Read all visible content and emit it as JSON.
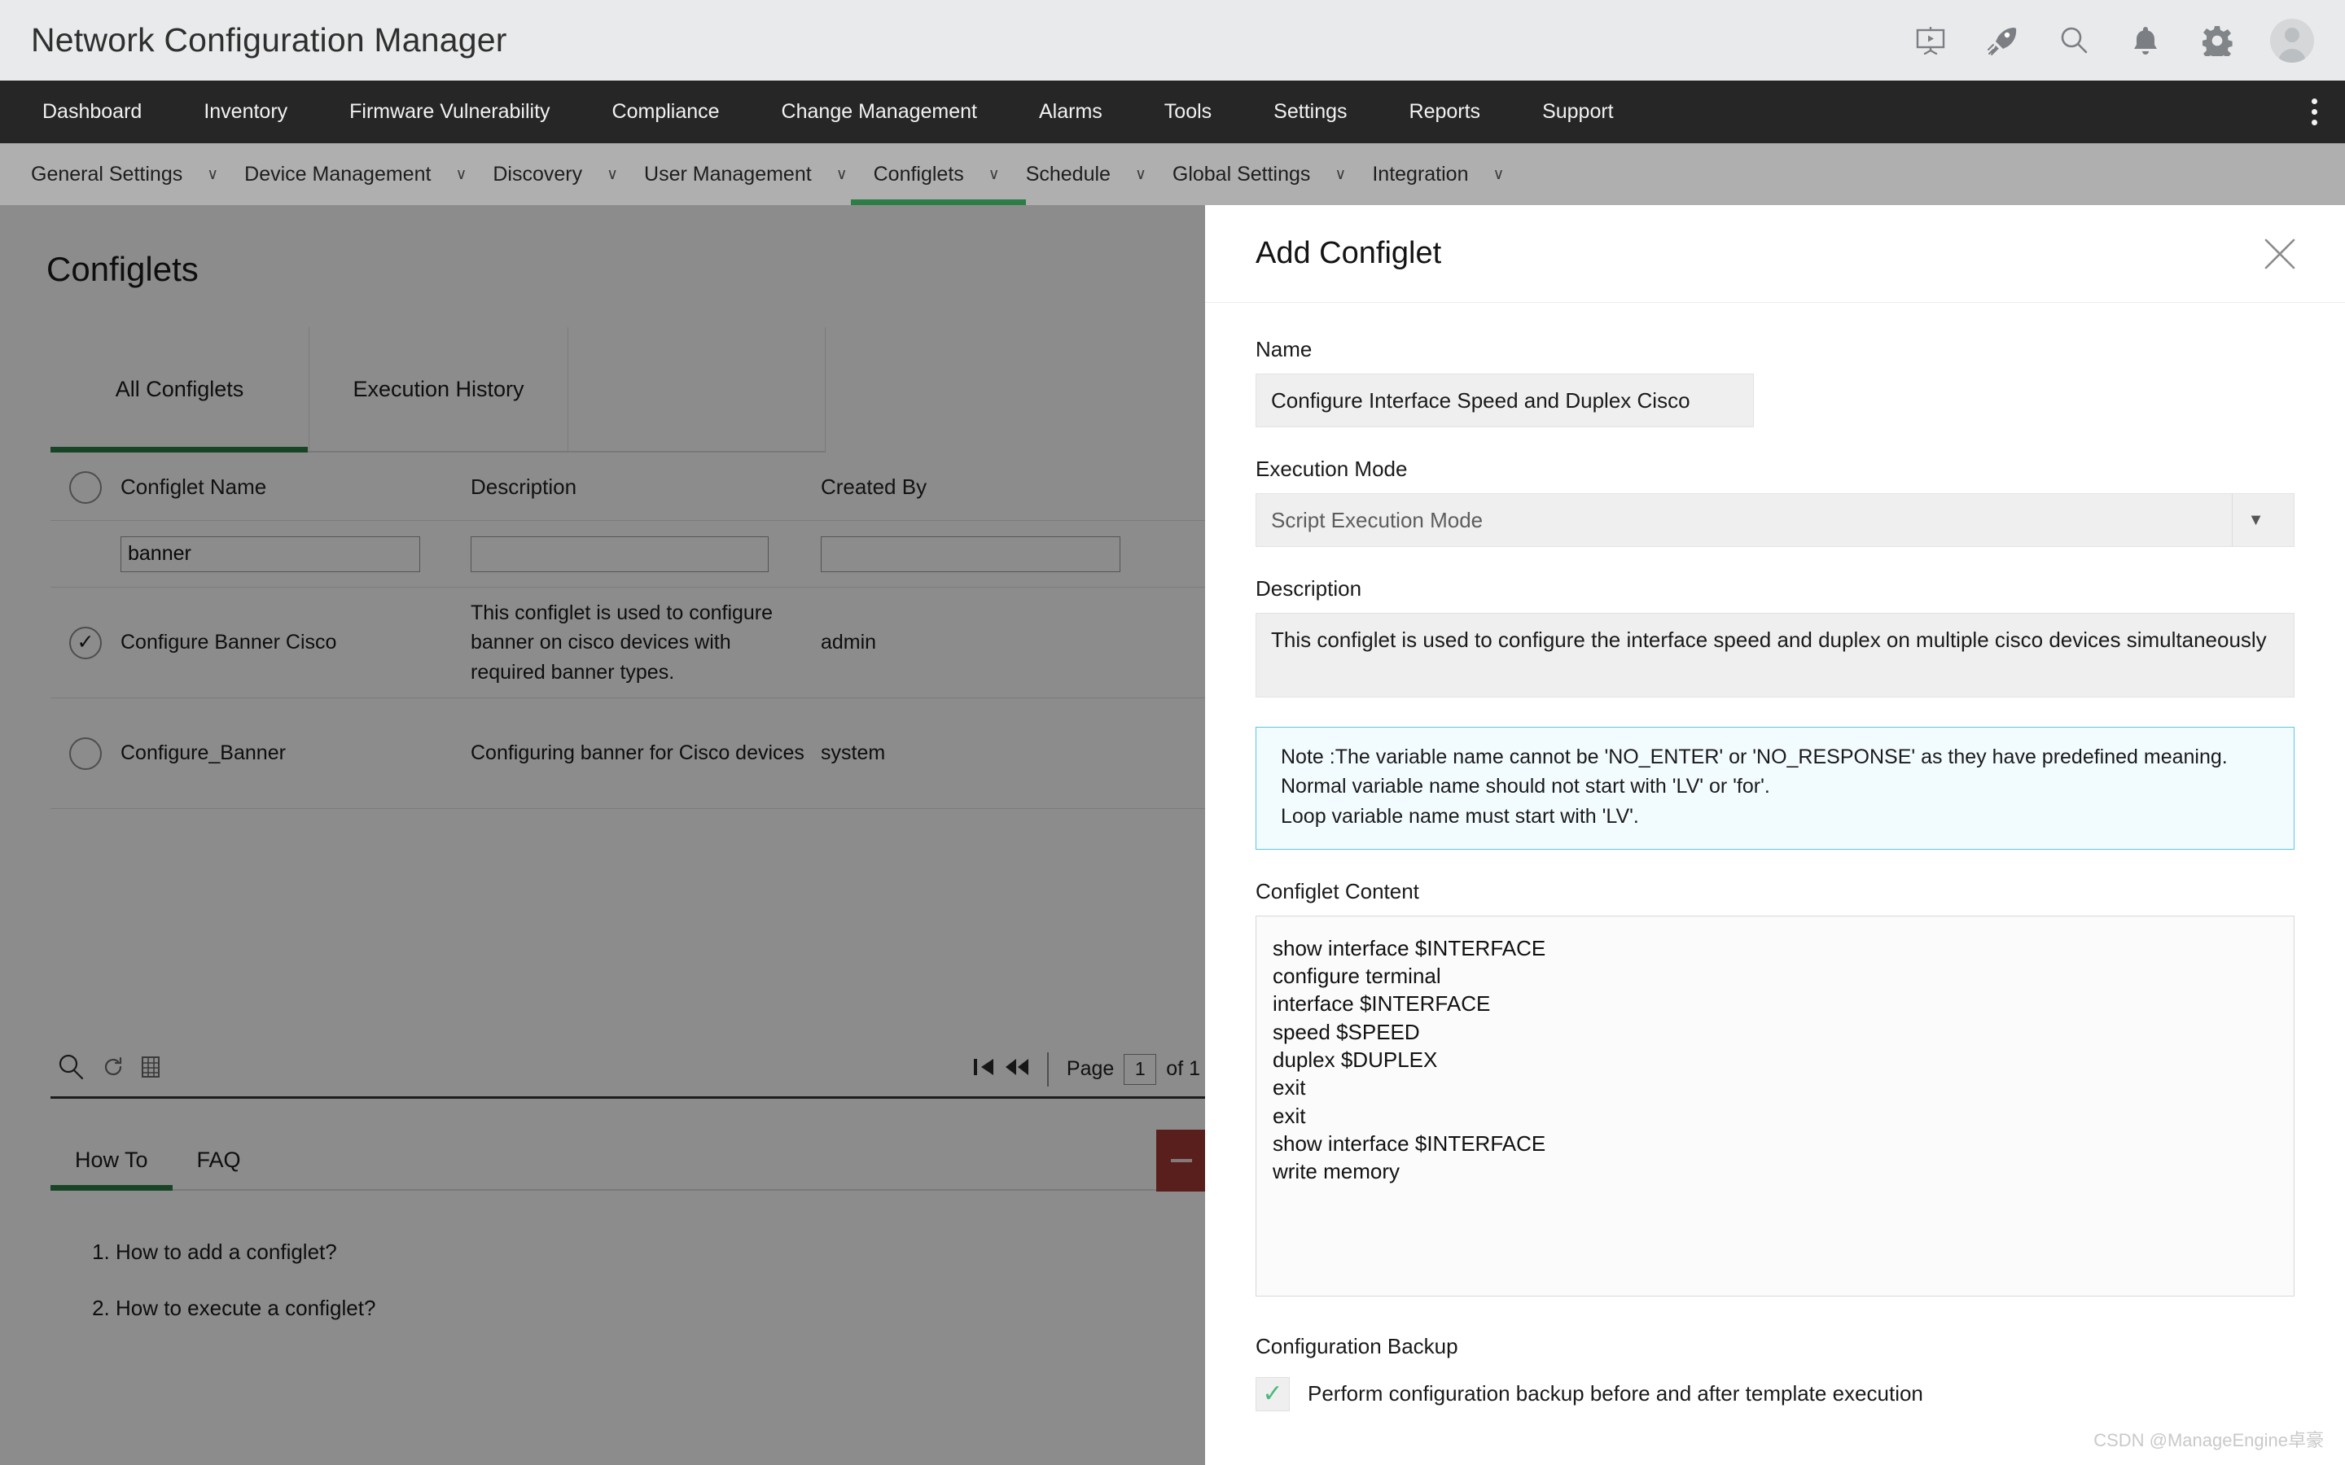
{
  "header": {
    "title": "Network Configuration Manager",
    "icons": [
      {
        "name": "presentation-demo-icon"
      },
      {
        "name": "rocket-icon"
      },
      {
        "name": "search-icon"
      },
      {
        "name": "bell-notification-icon"
      },
      {
        "name": "gear-settings-icon"
      },
      {
        "name": "user-avatar-icon"
      }
    ]
  },
  "main_nav": {
    "items": [
      {
        "label": "Dashboard"
      },
      {
        "label": "Inventory"
      },
      {
        "label": "Firmware Vulnerability"
      },
      {
        "label": "Compliance"
      },
      {
        "label": "Change Management"
      },
      {
        "label": "Alarms"
      },
      {
        "label": "Tools"
      },
      {
        "label": "Settings"
      },
      {
        "label": "Reports"
      },
      {
        "label": "Support"
      }
    ],
    "overflow_icon": "kebab-menu-icon"
  },
  "sub_nav": {
    "active": "Configlets",
    "items": [
      {
        "label": "General Settings",
        "caret": "∨"
      },
      {
        "label": "Device Management",
        "caret": "∨"
      },
      {
        "label": "Discovery",
        "caret": "∨"
      },
      {
        "label": "User Management",
        "caret": "∨"
      },
      {
        "label": "Configlets",
        "caret": "∨"
      },
      {
        "label": "Schedule",
        "caret": "∨"
      },
      {
        "label": "Global Settings",
        "caret": "∨"
      },
      {
        "label": "Integration",
        "caret": "∨"
      }
    ]
  },
  "page": {
    "title": "Configlets",
    "tabs": [
      {
        "label": "All Configlets",
        "active": true
      },
      {
        "label": "Execution History",
        "active": false
      }
    ]
  },
  "table": {
    "columns": [
      "Configlet Name",
      "Description",
      "Created By"
    ],
    "filters": {
      "configlet_name": "banner",
      "description": "",
      "created_by": ""
    },
    "rows": [
      {
        "selected": true,
        "name": "Configure Banner Cisco",
        "description": "This configlet is used to configure banner on cisco devices with required banner types.",
        "created_by": "admin"
      },
      {
        "selected": false,
        "name": "Configure_Banner",
        "description": "Configuring banner for Cisco devices",
        "created_by": "system"
      }
    ],
    "footer": {
      "icons": [
        "search-icon",
        "refresh-icon",
        "column-settings-icon"
      ],
      "first_page_icon": "first-page-icon",
      "prev_page_icon": "previous-page-icon",
      "page_label": "Page",
      "page_value": "1",
      "of_label": "of 1"
    }
  },
  "howto": {
    "tabs": [
      {
        "label": "How To",
        "active": true
      },
      {
        "label": "FAQ",
        "active": false
      }
    ],
    "collapse_icon": "minimize-icon",
    "items": [
      "How to add a configlet?",
      "How to execute a configlet?"
    ]
  },
  "panel": {
    "title": "Add Configlet",
    "close_icon": "close-icon",
    "name": {
      "label": "Name",
      "value": "Configure Interface Speed and Duplex Cisco"
    },
    "execution_mode": {
      "label": "Execution Mode",
      "value": "Script Execution Mode",
      "caret_icon": "chevron-down-icon"
    },
    "description": {
      "label": "Description",
      "value": "This configlet is used to configure the interface speed and duplex on multiple cisco devices simultaneously"
    },
    "note": {
      "lines": [
        "Note :The variable name cannot be 'NO_ENTER' or 'NO_RESPONSE' as they have predefined meaning.",
        "Normal variable name should not start with 'LV' or 'for'.",
        "Loop variable name must start with 'LV'."
      ]
    },
    "configlet_content": {
      "label": "Configlet Content",
      "value": "show interface $INTERFACE\nconfigure terminal\ninterface $INTERFACE\nspeed $SPEED\nduplex $DUPLEX\nexit\nexit\nshow interface $INTERFACE\nwrite memory"
    },
    "configuration_backup": {
      "label": "Configuration Backup",
      "checkbox_label": "Perform configuration backup before and after template execution",
      "checked": true,
      "check_icon": "checkmark-icon"
    }
  },
  "watermark": "CSDN @ManageEngine卓豪",
  "colors": {
    "accent_green": "#2d7d46",
    "nav_dark": "#262626",
    "subnav_grey": "#afafaf",
    "note_border": "#5fc4e8",
    "note_bg": "#f2fbfe",
    "collapse_red": "#a33a34",
    "check_green": "#4cb97a"
  }
}
